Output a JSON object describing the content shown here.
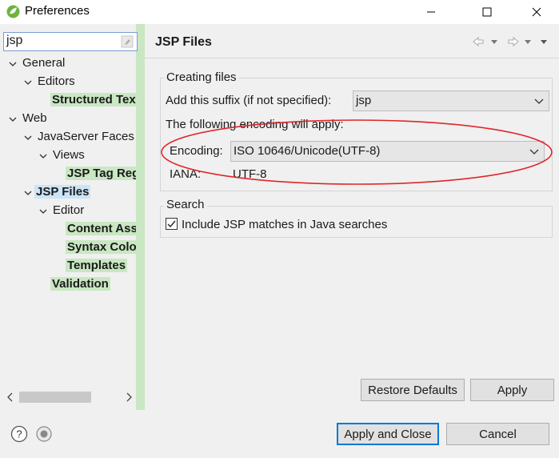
{
  "window": {
    "title": "Preferences"
  },
  "filter": {
    "value": "jsp"
  },
  "tree": {
    "general": "General",
    "editors": "Editors",
    "structured_text": "Structured Tex",
    "web": "Web",
    "jsf": "JavaServer Faces",
    "views": "Views",
    "jsp_tag_reg": "JSP Tag Reg",
    "jsp_files": "JSP Files",
    "editor": "Editor",
    "content_assist": "Content Ass",
    "syntax_coloring": "Syntax Colo",
    "templates": "Templates",
    "validation": "Validation"
  },
  "page": {
    "title": "JSP Files",
    "creating_group": "Creating files",
    "suffix_label": "Add this suffix (if not specified):",
    "suffix_value": "jsp",
    "encoding_info": "The following encoding will apply:",
    "encoding_label": "Encoding:",
    "encoding_value": "ISO 10646/Unicode(UTF-8)",
    "iana_label": "IANA:",
    "iana_value": "UTF-8",
    "search_group": "Search",
    "search_checkbox": "Include JSP matches in Java searches",
    "search_checked": true
  },
  "buttons": {
    "restore": "Restore Defaults",
    "apply": "Apply",
    "apply_close": "Apply and Close",
    "cancel": "Cancel"
  },
  "colors": {
    "highlight": "#c9e7c2",
    "selection": "#cce4f7",
    "accent": "#0078d7",
    "annotation": "#e0262b"
  },
  "icons": [
    "spring-app-icon",
    "minimize-icon",
    "maximize-icon",
    "close-icon",
    "clear-filter-icon",
    "back-icon",
    "forward-icon",
    "menu-icon",
    "help-icon",
    "record-icon"
  ]
}
